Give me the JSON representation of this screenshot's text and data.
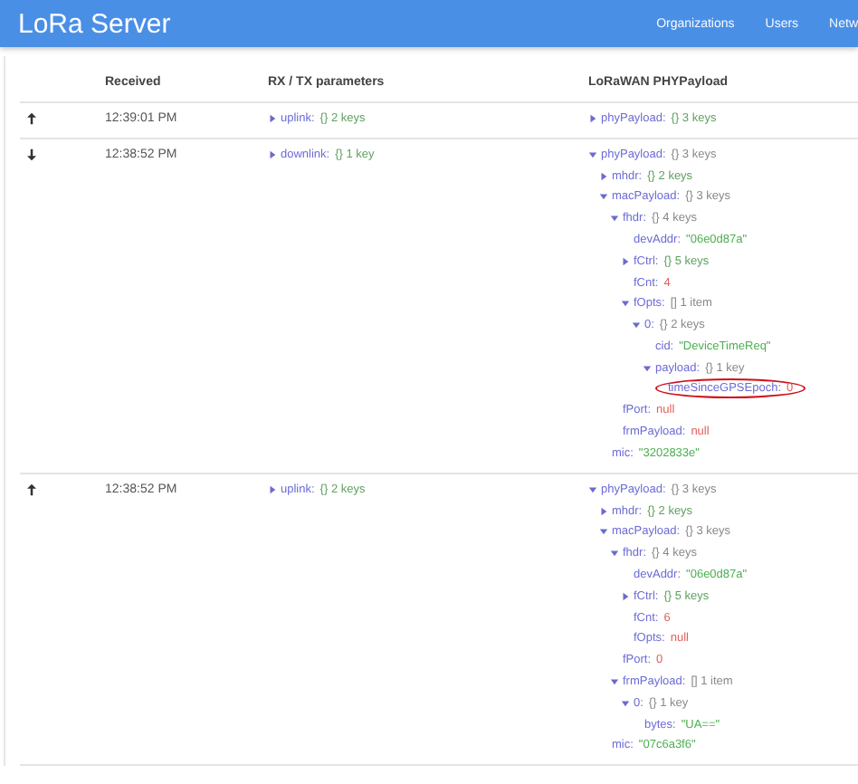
{
  "app_bar": {
    "title": "LoRa Server",
    "nav": [
      "Organizations",
      "Users",
      "Netw"
    ]
  },
  "table": {
    "columns": [
      "Received",
      "RX / TX parameters",
      "LoRaWAN PHYPayload"
    ],
    "rows": [
      {
        "uplink": true,
        "received": "12:39:01 PM",
        "rxtx": [
          {
            "key": "uplink:",
            "value": "{} 2 keys",
            "kind": "object",
            "expanded": false
          }
        ],
        "payload": [
          {
            "key": "phyPayload:",
            "value": "{} 3 keys",
            "kind": "object",
            "expanded": false
          }
        ]
      },
      {
        "uplink": false,
        "received": "12:38:52 PM",
        "rxtx": [
          {
            "key": "downlink:",
            "value": "{} 1 key",
            "kind": "object",
            "expanded": false
          }
        ],
        "payload": [
          {
            "key": "phyPayload:",
            "value": "{} 3 keys",
            "kind": "object",
            "expanded": true,
            "children": [
              {
                "key": "mhdr:",
                "value": "{} 2 keys",
                "kind": "object",
                "expanded": false
              },
              {
                "key": "macPayload:",
                "value": "{} 3 keys",
                "kind": "object",
                "expanded": true,
                "children": [
                  {
                    "key": "fhdr:",
                    "value": "{} 4 keys",
                    "kind": "object",
                    "expanded": true,
                    "children": [
                      {
                        "key": "devAddr:",
                        "value": "\"06e0d87a\"",
                        "kind": "string"
                      },
                      {
                        "key": "fCtrl:",
                        "value": "{} 5 keys",
                        "kind": "object",
                        "expanded": false
                      },
                      {
                        "key": "fCnt:",
                        "value": "4",
                        "kind": "number"
                      },
                      {
                        "key": "fOpts:",
                        "value": "[] 1 item",
                        "kind": "object",
                        "expanded": true,
                        "children": [
                          {
                            "key": "0:",
                            "value": "{} 2 keys",
                            "kind": "object",
                            "expanded": true,
                            "children": [
                              {
                                "key": "cid:",
                                "value": "\"DeviceTimeReq\"",
                                "kind": "string"
                              },
                              {
                                "key": "payload:",
                                "value": "{} 1 key",
                                "kind": "object",
                                "expanded": true,
                                "children": [
                                  {
                                    "key": "timeSinceGPSEpoch:",
                                    "value": "0",
                                    "kind": "number",
                                    "circled": true
                                  }
                                ]
                              }
                            ]
                          }
                        ]
                      }
                    ]
                  },
                  {
                    "key": "fPort:",
                    "value": "null",
                    "kind": "null"
                  },
                  {
                    "key": "frmPayload:",
                    "value": "null",
                    "kind": "null"
                  }
                ]
              },
              {
                "key": "mic:",
                "value": "\"3202833e\"",
                "kind": "string"
              }
            ]
          }
        ]
      },
      {
        "uplink": true,
        "received": "12:38:52 PM",
        "rxtx": [
          {
            "key": "uplink:",
            "value": "{} 2 keys",
            "kind": "object",
            "expanded": false
          }
        ],
        "payload": [
          {
            "key": "phyPayload:",
            "value": "{} 3 keys",
            "kind": "object",
            "expanded": true,
            "children": [
              {
                "key": "mhdr:",
                "value": "{} 2 keys",
                "kind": "object",
                "expanded": false
              },
              {
                "key": "macPayload:",
                "value": "{} 3 keys",
                "kind": "object",
                "expanded": true,
                "children": [
                  {
                    "key": "fhdr:",
                    "value": "{} 4 keys",
                    "kind": "object",
                    "expanded": true,
                    "children": [
                      {
                        "key": "devAddr:",
                        "value": "\"06e0d87a\"",
                        "kind": "string"
                      },
                      {
                        "key": "fCtrl:",
                        "value": "{} 5 keys",
                        "kind": "object",
                        "expanded": false
                      },
                      {
                        "key": "fCnt:",
                        "value": "6",
                        "kind": "number"
                      },
                      {
                        "key": "fOpts:",
                        "value": "null",
                        "kind": "null"
                      }
                    ]
                  },
                  {
                    "key": "fPort:",
                    "value": "0",
                    "kind": "number"
                  },
                  {
                    "key": "frmPayload:",
                    "value": "[] 1 item",
                    "kind": "object",
                    "expanded": true,
                    "children": [
                      {
                        "key": "0:",
                        "value": "{} 1 key",
                        "kind": "object",
                        "expanded": true,
                        "children": [
                          {
                            "key": "bytes:",
                            "value": "\"UA==\"",
                            "kind": "string"
                          }
                        ]
                      }
                    ]
                  }
                ]
              },
              {
                "key": "mic:",
                "value": "\"07c6a3f6\"",
                "kind": "string"
              }
            ]
          }
        ]
      }
    ]
  }
}
